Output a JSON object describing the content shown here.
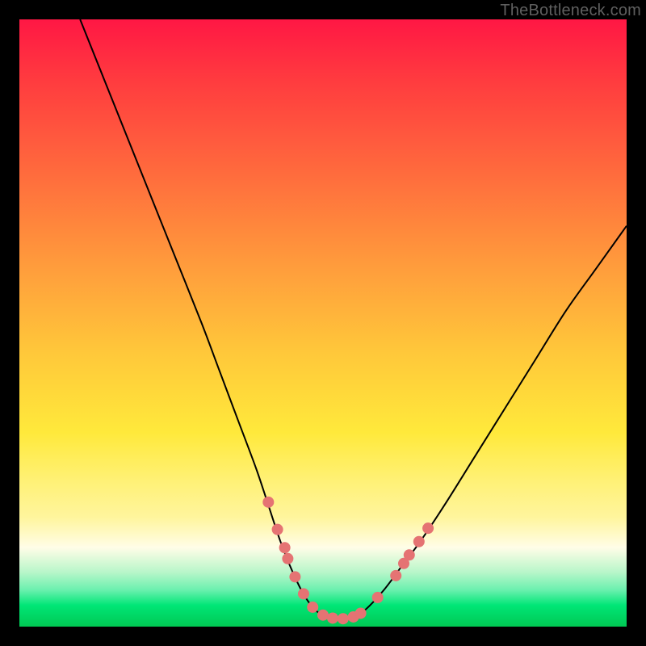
{
  "watermark": "TheBottleneck.com",
  "chart_data": {
    "type": "line",
    "title": "",
    "xlabel": "",
    "ylabel": "",
    "xlim": [
      0,
      100
    ],
    "ylim": [
      0,
      100
    ],
    "curve": {
      "name": "bottleneck-curve",
      "color": "#000000",
      "stroke_width": 2,
      "points": [
        {
          "x": 10,
          "y": 100
        },
        {
          "x": 14,
          "y": 90
        },
        {
          "x": 18,
          "y": 80
        },
        {
          "x": 22,
          "y": 70
        },
        {
          "x": 26,
          "y": 60
        },
        {
          "x": 30,
          "y": 50
        },
        {
          "x": 33,
          "y": 42
        },
        {
          "x": 36,
          "y": 34
        },
        {
          "x": 39,
          "y": 26
        },
        {
          "x": 41,
          "y": 20
        },
        {
          "x": 43,
          "y": 14
        },
        {
          "x": 45,
          "y": 9
        },
        {
          "x": 47,
          "y": 5
        },
        {
          "x": 49,
          "y": 2.5
        },
        {
          "x": 51,
          "y": 1.5
        },
        {
          "x": 53,
          "y": 1.2
        },
        {
          "x": 55,
          "y": 1.5
        },
        {
          "x": 57,
          "y": 2.8
        },
        {
          "x": 60,
          "y": 6
        },
        {
          "x": 63,
          "y": 10
        },
        {
          "x": 66,
          "y": 14
        },
        {
          "x": 70,
          "y": 20
        },
        {
          "x": 75,
          "y": 28
        },
        {
          "x": 80,
          "y": 36
        },
        {
          "x": 85,
          "y": 44
        },
        {
          "x": 90,
          "y": 52
        },
        {
          "x": 95,
          "y": 59
        },
        {
          "x": 100,
          "y": 66
        }
      ]
    },
    "markers": {
      "name": "highlight-dots",
      "color": "#e57373",
      "radius": 7,
      "points": [
        {
          "x": 41.0,
          "y": 20.5
        },
        {
          "x": 42.5,
          "y": 16.0
        },
        {
          "x": 43.7,
          "y": 13.0
        },
        {
          "x": 44.2,
          "y": 11.2
        },
        {
          "x": 45.4,
          "y": 8.2
        },
        {
          "x": 46.8,
          "y": 5.4
        },
        {
          "x": 48.3,
          "y": 3.2
        },
        {
          "x": 50.0,
          "y": 1.9
        },
        {
          "x": 51.6,
          "y": 1.4
        },
        {
          "x": 53.3,
          "y": 1.3
        },
        {
          "x": 55.0,
          "y": 1.6
        },
        {
          "x": 56.2,
          "y": 2.2
        },
        {
          "x": 59.0,
          "y": 4.8
        },
        {
          "x": 62.0,
          "y": 8.4
        },
        {
          "x": 63.3,
          "y": 10.4
        },
        {
          "x": 64.2,
          "y": 11.8
        },
        {
          "x": 65.8,
          "y": 14.0
        },
        {
          "x": 67.3,
          "y": 16.2
        }
      ]
    }
  }
}
